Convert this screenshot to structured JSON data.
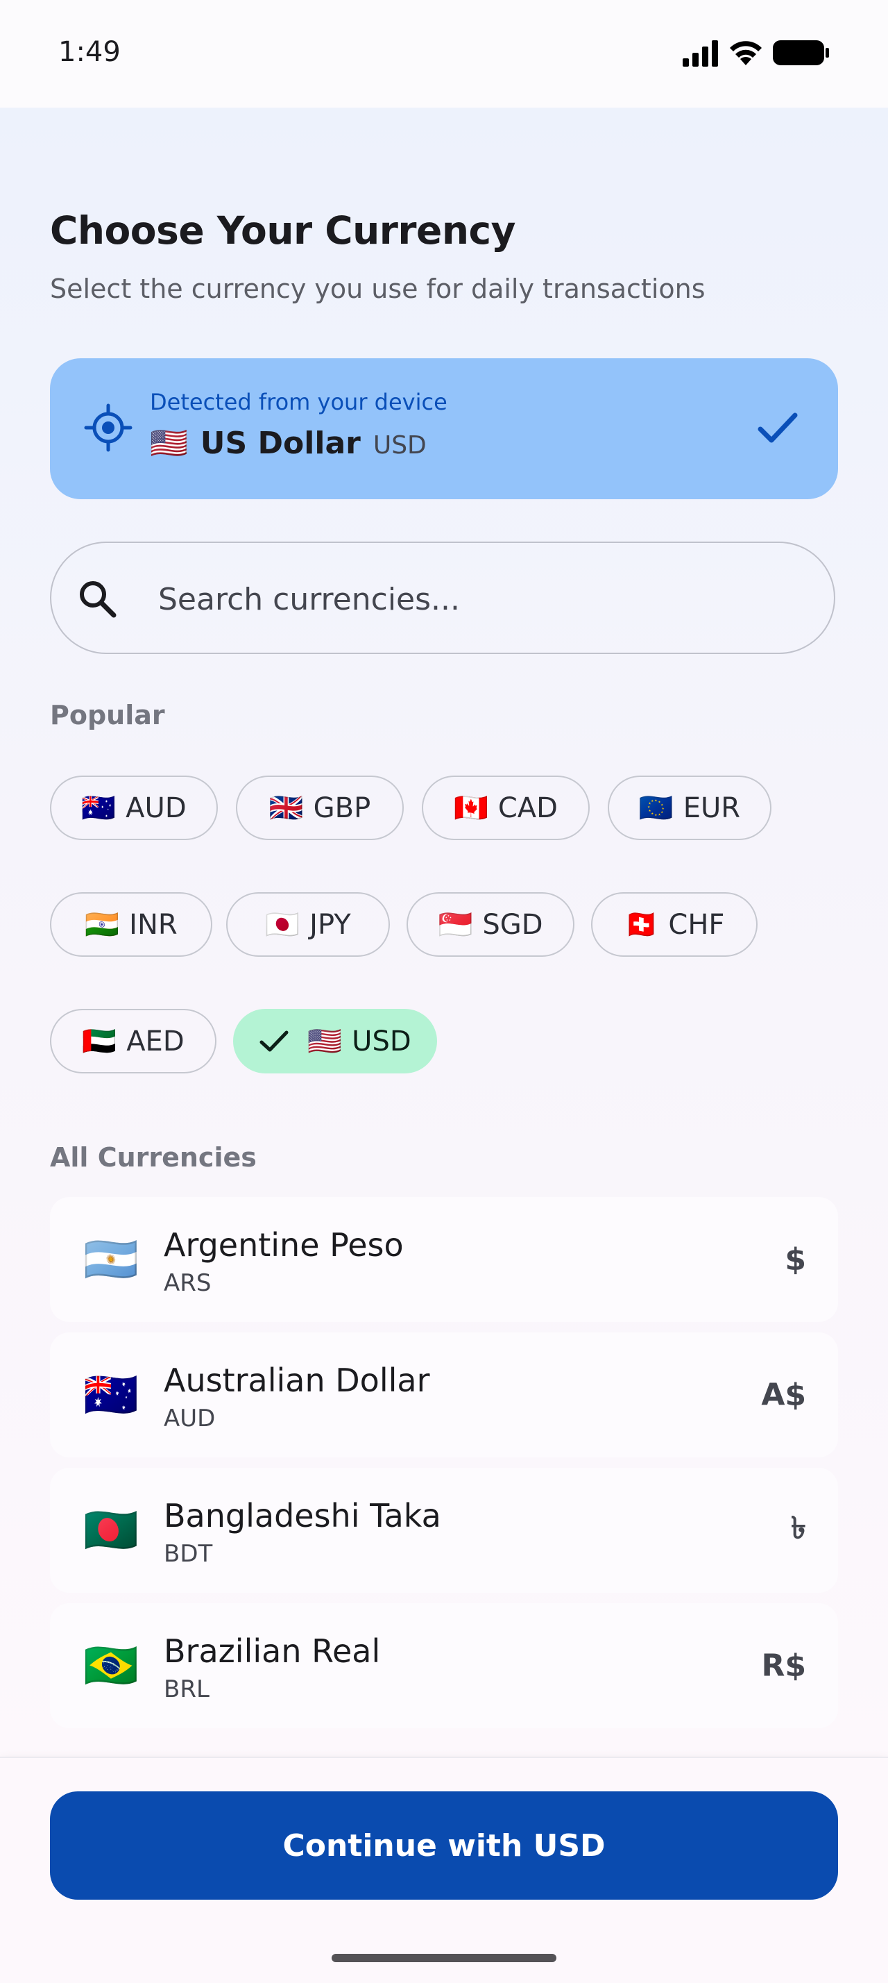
{
  "status_bar": {
    "time": "1:49"
  },
  "header": {
    "title": "Choose Your Currency",
    "subtitle": "Select the currency you use for daily transactions"
  },
  "detected": {
    "label": "Detected from your device",
    "flag": "🇺🇸",
    "name": "US Dollar",
    "code": "USD"
  },
  "search": {
    "placeholder": "Search currencies...",
    "value": ""
  },
  "popular": {
    "label": "Popular",
    "chips": [
      {
        "flag": "🇦🇺",
        "code": "AUD"
      },
      {
        "flag": "🇬🇧",
        "code": "GBP"
      },
      {
        "flag": "🇨🇦",
        "code": "CAD"
      },
      {
        "flag": "🇪🇺",
        "code": "EUR"
      },
      {
        "flag": "🇮🇳",
        "code": "INR"
      },
      {
        "flag": "🇯🇵",
        "code": "JPY"
      },
      {
        "flag": "🇸🇬",
        "code": "SGD"
      },
      {
        "flag": "🇨🇭",
        "code": "CHF"
      },
      {
        "flag": "🇦🇪",
        "code": "AED"
      },
      {
        "flag": "🇺🇸",
        "code": "USD",
        "selected": true
      }
    ]
  },
  "all": {
    "label": "All Currencies",
    "items": [
      {
        "flag": "🇦🇷",
        "name": "Argentine Peso",
        "code": "ARS",
        "symbol": "$"
      },
      {
        "flag": "🇦🇺",
        "name": "Australian Dollar",
        "code": "AUD",
        "symbol": "A$"
      },
      {
        "flag": "🇧🇩",
        "name": "Bangladeshi Taka",
        "code": "BDT",
        "symbol": "৳"
      },
      {
        "flag": "🇧🇷",
        "name": "Brazilian Real",
        "code": "BRL",
        "symbol": "R$"
      }
    ]
  },
  "footer": {
    "continue_label": "Continue with USD"
  },
  "colors": {
    "primary": "#0a4baf",
    "detected_bg": "#93c3fa",
    "selected_chip_bg": "#b4f3d4"
  }
}
